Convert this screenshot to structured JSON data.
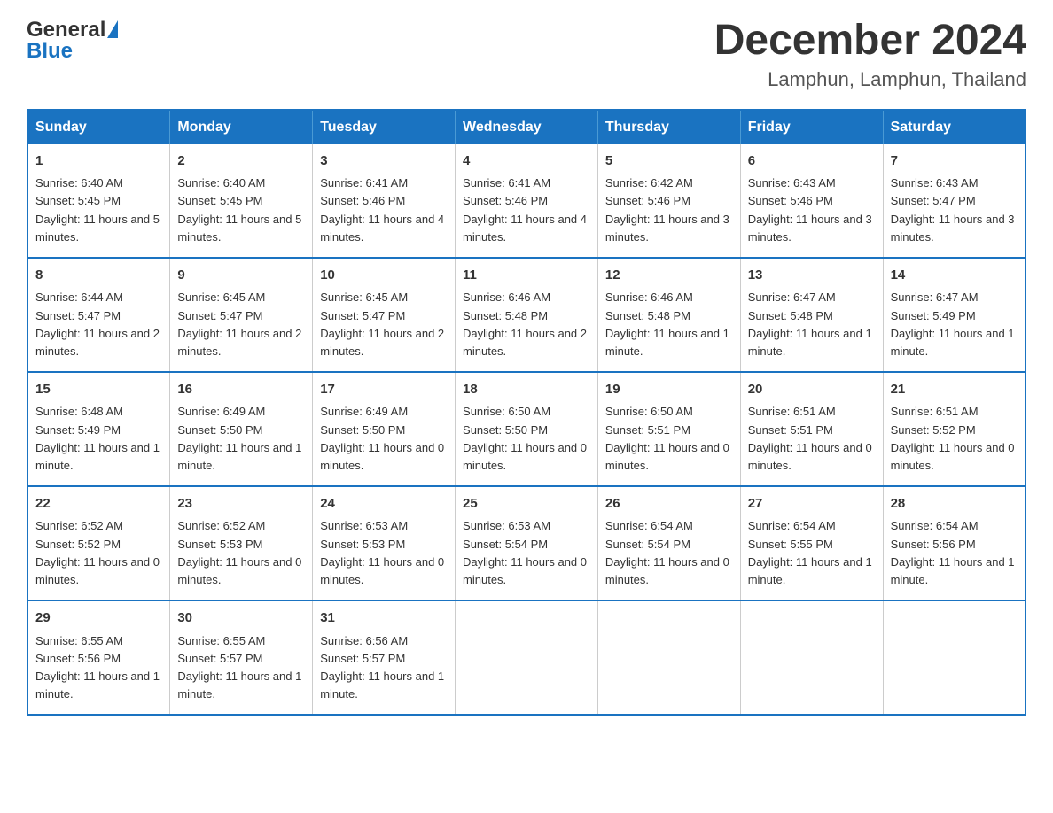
{
  "header": {
    "logo": {
      "general": "General",
      "blue": "Blue",
      "alt": "GeneralBlue logo"
    },
    "title": "December 2024",
    "subtitle": "Lamphun, Lamphun, Thailand"
  },
  "days_of_week": [
    "Sunday",
    "Monday",
    "Tuesday",
    "Wednesday",
    "Thursday",
    "Friday",
    "Saturday"
  ],
  "weeks": [
    [
      {
        "day": "1",
        "sunrise": "6:40 AM",
        "sunset": "5:45 PM",
        "daylight": "11 hours and 5 minutes."
      },
      {
        "day": "2",
        "sunrise": "6:40 AM",
        "sunset": "5:45 PM",
        "daylight": "11 hours and 5 minutes."
      },
      {
        "day": "3",
        "sunrise": "6:41 AM",
        "sunset": "5:46 PM",
        "daylight": "11 hours and 4 minutes."
      },
      {
        "day": "4",
        "sunrise": "6:41 AM",
        "sunset": "5:46 PM",
        "daylight": "11 hours and 4 minutes."
      },
      {
        "day": "5",
        "sunrise": "6:42 AM",
        "sunset": "5:46 PM",
        "daylight": "11 hours and 3 minutes."
      },
      {
        "day": "6",
        "sunrise": "6:43 AM",
        "sunset": "5:46 PM",
        "daylight": "11 hours and 3 minutes."
      },
      {
        "day": "7",
        "sunrise": "6:43 AM",
        "sunset": "5:47 PM",
        "daylight": "11 hours and 3 minutes."
      }
    ],
    [
      {
        "day": "8",
        "sunrise": "6:44 AM",
        "sunset": "5:47 PM",
        "daylight": "11 hours and 2 minutes."
      },
      {
        "day": "9",
        "sunrise": "6:45 AM",
        "sunset": "5:47 PM",
        "daylight": "11 hours and 2 minutes."
      },
      {
        "day": "10",
        "sunrise": "6:45 AM",
        "sunset": "5:47 PM",
        "daylight": "11 hours and 2 minutes."
      },
      {
        "day": "11",
        "sunrise": "6:46 AM",
        "sunset": "5:48 PM",
        "daylight": "11 hours and 2 minutes."
      },
      {
        "day": "12",
        "sunrise": "6:46 AM",
        "sunset": "5:48 PM",
        "daylight": "11 hours and 1 minute."
      },
      {
        "day": "13",
        "sunrise": "6:47 AM",
        "sunset": "5:48 PM",
        "daylight": "11 hours and 1 minute."
      },
      {
        "day": "14",
        "sunrise": "6:47 AM",
        "sunset": "5:49 PM",
        "daylight": "11 hours and 1 minute."
      }
    ],
    [
      {
        "day": "15",
        "sunrise": "6:48 AM",
        "sunset": "5:49 PM",
        "daylight": "11 hours and 1 minute."
      },
      {
        "day": "16",
        "sunrise": "6:49 AM",
        "sunset": "5:50 PM",
        "daylight": "11 hours and 1 minute."
      },
      {
        "day": "17",
        "sunrise": "6:49 AM",
        "sunset": "5:50 PM",
        "daylight": "11 hours and 0 minutes."
      },
      {
        "day": "18",
        "sunrise": "6:50 AM",
        "sunset": "5:50 PM",
        "daylight": "11 hours and 0 minutes."
      },
      {
        "day": "19",
        "sunrise": "6:50 AM",
        "sunset": "5:51 PM",
        "daylight": "11 hours and 0 minutes."
      },
      {
        "day": "20",
        "sunrise": "6:51 AM",
        "sunset": "5:51 PM",
        "daylight": "11 hours and 0 minutes."
      },
      {
        "day": "21",
        "sunrise": "6:51 AM",
        "sunset": "5:52 PM",
        "daylight": "11 hours and 0 minutes."
      }
    ],
    [
      {
        "day": "22",
        "sunrise": "6:52 AM",
        "sunset": "5:52 PM",
        "daylight": "11 hours and 0 minutes."
      },
      {
        "day": "23",
        "sunrise": "6:52 AM",
        "sunset": "5:53 PM",
        "daylight": "11 hours and 0 minutes."
      },
      {
        "day": "24",
        "sunrise": "6:53 AM",
        "sunset": "5:53 PM",
        "daylight": "11 hours and 0 minutes."
      },
      {
        "day": "25",
        "sunrise": "6:53 AM",
        "sunset": "5:54 PM",
        "daylight": "11 hours and 0 minutes."
      },
      {
        "day": "26",
        "sunrise": "6:54 AM",
        "sunset": "5:54 PM",
        "daylight": "11 hours and 0 minutes."
      },
      {
        "day": "27",
        "sunrise": "6:54 AM",
        "sunset": "5:55 PM",
        "daylight": "11 hours and 1 minute."
      },
      {
        "day": "28",
        "sunrise": "6:54 AM",
        "sunset": "5:56 PM",
        "daylight": "11 hours and 1 minute."
      }
    ],
    [
      {
        "day": "29",
        "sunrise": "6:55 AM",
        "sunset": "5:56 PM",
        "daylight": "11 hours and 1 minute."
      },
      {
        "day": "30",
        "sunrise": "6:55 AM",
        "sunset": "5:57 PM",
        "daylight": "11 hours and 1 minute."
      },
      {
        "day": "31",
        "sunrise": "6:56 AM",
        "sunset": "5:57 PM",
        "daylight": "11 hours and 1 minute."
      },
      null,
      null,
      null,
      null
    ]
  ]
}
